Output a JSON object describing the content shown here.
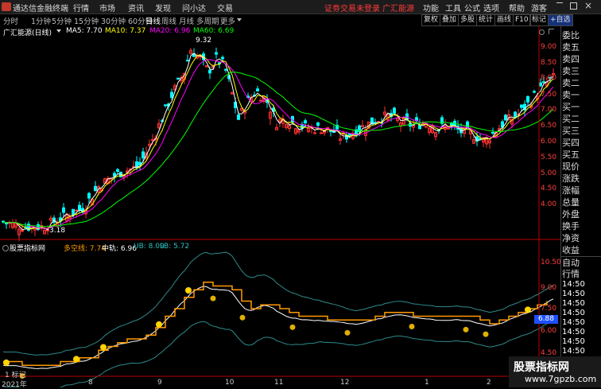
{
  "app": {
    "title": "通达信金融终端"
  },
  "menu": [
    "行情",
    "市场",
    "资讯",
    "发现",
    "问小达",
    "交易"
  ],
  "notice": "证劵交易未登录  广汇能源",
  "right_menu": [
    "功能",
    "工具",
    "公式",
    "选项",
    "帮助",
    "游客"
  ],
  "timeframes": [
    "分时",
    "1分钟",
    "5分钟",
    "15分钟",
    "30分钟",
    "60分钟",
    "日线",
    "周线",
    "月线",
    "多周期",
    "更多"
  ],
  "active_timeframe": "日线",
  "toolbar_buttons": [
    "复权",
    "叠加",
    "多股",
    "统计",
    "画线",
    "F10",
    "标记",
    "+自选"
  ],
  "main_panel": {
    "title": "广汇能源(日线)",
    "ma5_label": "MA5: 7.70",
    "ma10_label": "MA10: 7.37",
    "ma20_label": "MA20: 6.96",
    "ma60_label": "MA60: 6.69",
    "high_label": "9.32",
    "low_label": "3.18",
    "y_ticks": [
      "9.00",
      "8.00",
      "7.00",
      "6.00",
      "5.00",
      "4.00"
    ],
    "y_minor_ticks": [
      "8.50",
      "7.50",
      "6.50",
      "5.50",
      "4.50"
    ]
  },
  "sub_panel": {
    "title": "股票指标网",
    "duokong_label": "多空线: 7.74",
    "mid_label": "中轨: 6.96",
    "ub_label": "UB: 8.09",
    "lb_label": "LB: 5.72",
    "y_ticks": [
      "10.50",
      "9.00",
      "7.50",
      "6.00",
      "4.50"
    ],
    "value_badge": "6.88",
    "start_label": "1 标记"
  },
  "x_axis": [
    "2021年",
    "8",
    "9",
    "10",
    "11",
    "12",
    "1",
    "2"
  ],
  "right_panel": {
    "labels": [
      "委比",
      "卖五",
      "卖四",
      "卖三",
      "卖二",
      "卖一",
      "买一",
      "买二",
      "买三",
      "买四",
      "买五",
      "现价",
      "涨跌",
      "涨幅",
      "总量",
      "外盘",
      "换手",
      "净资",
      "收益"
    ],
    "tick_header": [
      "自动",
      "行情"
    ],
    "ticks": [
      "14:50",
      "14:50",
      "14:50",
      "14:50",
      "14:50",
      "14:50",
      "14:50",
      "14:50",
      "14:50",
      "14:50",
      "14:50",
      "14:50"
    ]
  },
  "watermark": {
    "line1": "股票指标网",
    "line2": "www.7gpzb.com"
  },
  "colors": {
    "up": "#ff3232",
    "down": "#00ffff",
    "ma5": "#ffffff",
    "ma10": "#ffff00",
    "ma20": "#ff00ff",
    "ma60": "#00ff00",
    "duokong": "#ff9a00",
    "band": "#2e8b8b",
    "badge": "#1e50ff"
  }
}
